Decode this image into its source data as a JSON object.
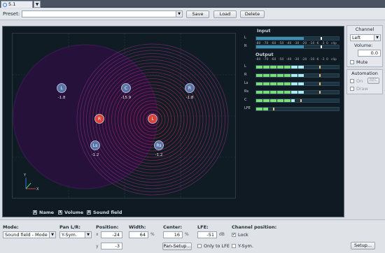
{
  "tab": {
    "title": "5.1 Master",
    "dropdown": "▼"
  },
  "preset": {
    "label": "Preset:",
    "value": "",
    "save": "Save",
    "load": "Load",
    "delete": "Delete"
  },
  "colors": {
    "accent": "#3a7bd5",
    "meter_green": "#7bdc7b",
    "meter_cyan": "#aee8f0",
    "meter_peak": "#e8c27a",
    "speaker_blue": "#5a74a8",
    "speaker_red": "#d8433a"
  },
  "speakers": [
    {
      "name": "L",
      "value": "-1.8",
      "color": "blue"
    },
    {
      "name": "C",
      "value": "-15.9",
      "color": "blue"
    },
    {
      "name": "R",
      "value": "-1.8",
      "color": "blue"
    },
    {
      "name": "R",
      "value": "",
      "color": "red"
    },
    {
      "name": "L",
      "value": "",
      "color": "red"
    },
    {
      "name": "Ls",
      "value": "-1.2",
      "color": "blue"
    },
    {
      "name": "Rs",
      "value": "-1.2",
      "color": "blue"
    }
  ],
  "axis": {
    "x": "X",
    "y": "Y"
  },
  "meters": {
    "input_title": "Input",
    "output_title": "Output",
    "scale": [
      "-80",
      "-70",
      "-60",
      "-50",
      "-40",
      "-30",
      "-20",
      "-10",
      "-6",
      "-3",
      "0",
      "clip"
    ],
    "input": [
      {
        "label": "L",
        "level": 0.58,
        "peak": 0.78
      },
      {
        "label": "R",
        "level": 0.58,
        "peak": 0.78
      }
    ],
    "output": [
      {
        "label": "L",
        "level": 0.58,
        "peak": 0.76
      },
      {
        "label": "R",
        "level": 0.58,
        "peak": 0.76
      },
      {
        "label": "Ls",
        "level": 0.58,
        "peak": 0.76
      },
      {
        "label": "Rs",
        "level": 0.58,
        "peak": 0.76
      },
      {
        "label": "C",
        "level": 0.47,
        "peak": 0.53
      },
      {
        "label": "LFE",
        "level": 0.14,
        "peak": 0.2
      }
    ]
  },
  "display_checks": [
    {
      "label": "Name",
      "checked": true
    },
    {
      "label": "Volume",
      "checked": true
    },
    {
      "label": "Sound field",
      "checked": true
    }
  ],
  "channel": {
    "title": "Channel",
    "select": "Left",
    "volume_label": "Volume:",
    "volume": "0.0",
    "mute": "Mute"
  },
  "automation": {
    "title": "Automation",
    "on": "On",
    "rec": "REC",
    "draw": "Draw"
  },
  "bottom": {
    "mode_label": "Mode:",
    "mode_value": "Sound field - Mode",
    "panlr_label": "Pan L/R:",
    "panlr_value": "Y-Sym.",
    "position_label": "Position:",
    "x_label": "x",
    "x_value": "-24",
    "y_label": "y",
    "y_value": "-3",
    "width_label": "Width:",
    "width_value": "64",
    "width_unit": "%",
    "center_label": "Center:",
    "center_value": "16",
    "center_unit": "%",
    "pan_setup": "Pan-Setup...",
    "lfe_label": "LFE:",
    "lfe_value": "-51",
    "lfe_unit": "dB",
    "only_lfe": "Only to LFE",
    "chanpos_label": "Channel position:",
    "lock": "Lock",
    "ysym": "Y-Sym.",
    "setup": "Setup..."
  }
}
